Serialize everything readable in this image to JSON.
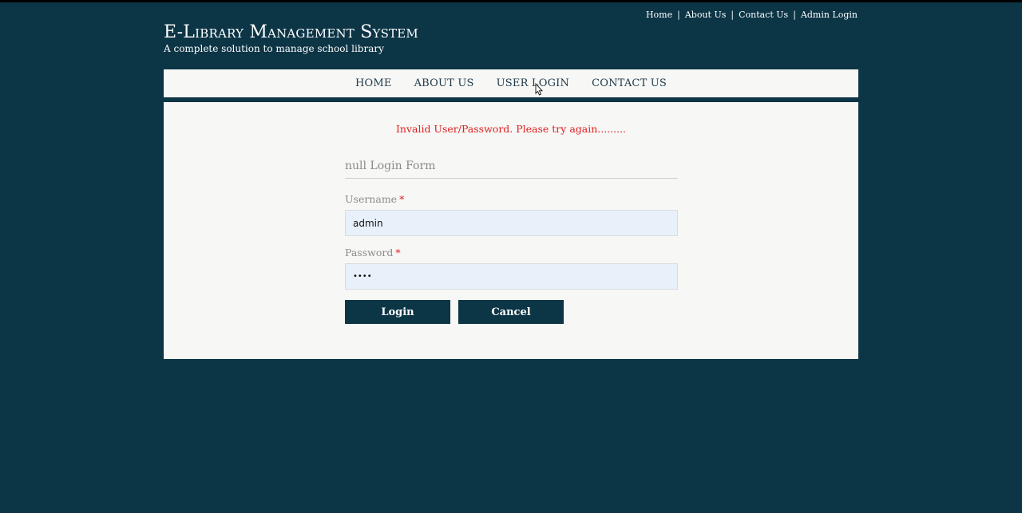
{
  "top_links": {
    "home": "Home",
    "about": "About Us",
    "contact": "Contact Us",
    "admin_login": "Admin Login",
    "separator": "|"
  },
  "brand": {
    "title": "E-Library Management System",
    "tagline": "A complete solution to manage school library"
  },
  "nav": {
    "items": [
      {
        "label": "HOME"
      },
      {
        "label": "ABOUT US"
      },
      {
        "label": "USER LOGIN"
      },
      {
        "label": "CONTACT US"
      }
    ]
  },
  "login": {
    "error": "Invalid User/Password. Please try again.........",
    "form_title": "null Login Form",
    "username_label": "Username",
    "password_label": "Password",
    "required_mark": "*",
    "username_value": "admin",
    "password_value": "••••",
    "login_button": "Login",
    "cancel_button": "Cancel"
  },
  "colors": {
    "background": "#0c3546",
    "panel": "#f7f7f5",
    "error": "#e01f1f",
    "input_bg": "#e8f0fa"
  },
  "icons": {
    "cursor": "mouse-pointer-icon"
  }
}
